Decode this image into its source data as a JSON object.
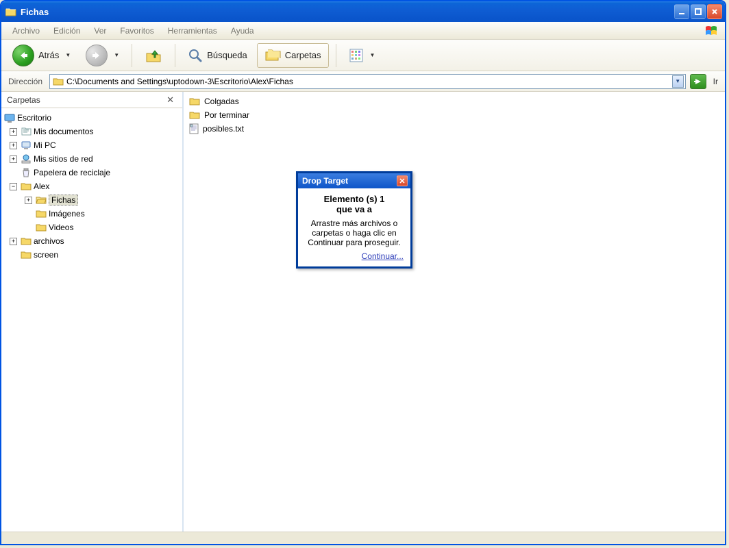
{
  "window": {
    "title": "Fichas"
  },
  "menu": {
    "archivo": "Archivo",
    "edicion": "Edición",
    "ver": "Ver",
    "favoritos": "Favoritos",
    "herramientas": "Herramientas",
    "ayuda": "Ayuda"
  },
  "toolbar": {
    "back": "Atrás",
    "search": "Búsqueda",
    "folders": "Carpetas"
  },
  "address": {
    "label": "Dirección",
    "path": "C:\\Documents and Settings\\uptodown-3\\Escritorio\\Alex\\Fichas",
    "go": "Ir"
  },
  "sidebar": {
    "title": "Carpetas",
    "tree": {
      "root": "Escritorio",
      "items": [
        {
          "label": "Mis documentos",
          "expandable": true
        },
        {
          "label": "Mi PC",
          "expandable": true
        },
        {
          "label": "Mis sitios de red",
          "expandable": true
        },
        {
          "label": "Papelera de reciclaje",
          "expandable": false
        },
        {
          "label": "Alex",
          "expandable": true,
          "expanded": true,
          "children": [
            {
              "label": "Fichas",
              "expandable": true,
              "selected": true
            },
            {
              "label": "Imágenes",
              "expandable": false
            },
            {
              "label": "Videos",
              "expandable": false
            }
          ]
        },
        {
          "label": "archivos",
          "expandable": true
        },
        {
          "label": "screen",
          "expandable": false
        }
      ]
    }
  },
  "files": [
    {
      "name": "Colgadas",
      "type": "folder"
    },
    {
      "name": "Por terminar",
      "type": "folder"
    },
    {
      "name": "posibles.txt",
      "type": "text"
    }
  ],
  "dialog": {
    "title": "Drop Target",
    "headline1": "Elemento (s) 1",
    "headline2": "que va a",
    "message": "Arrastre más archivos o carpetas o haga clic en Continuar para proseguir.",
    "continue": "Continuar..."
  }
}
